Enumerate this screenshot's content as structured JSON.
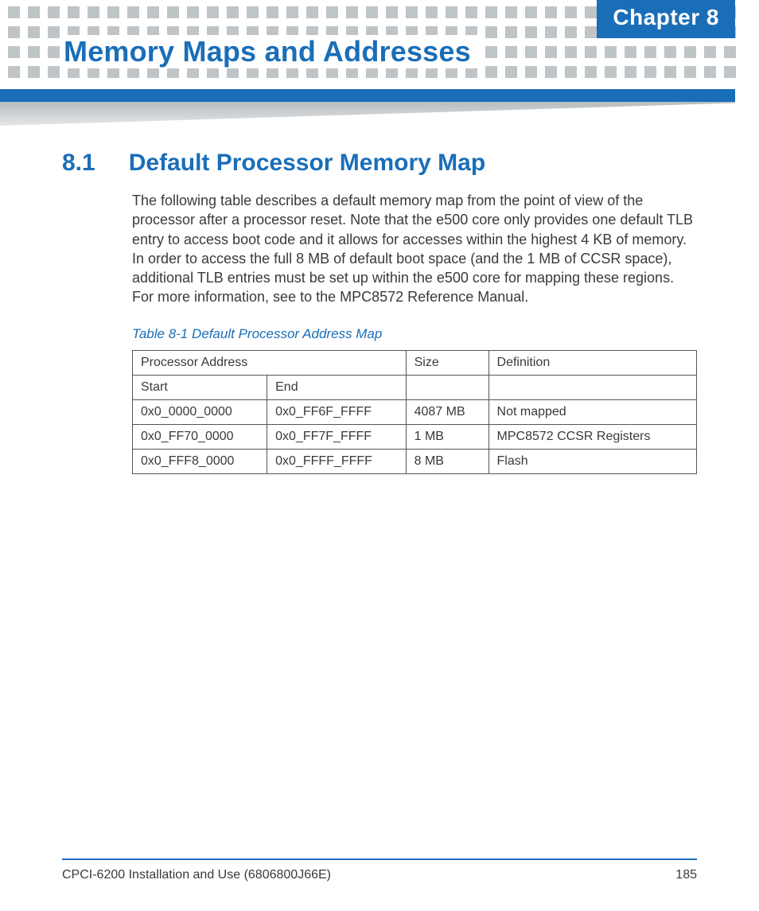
{
  "header": {
    "chapter_label": "Chapter 8",
    "page_title": "Memory Maps and Addresses"
  },
  "section": {
    "number": "8.1",
    "title": "Default Processor Memory Map",
    "paragraph": "The following table describes a default memory map from the point of view of the processor after a processor reset. Note that the e500 core only provides one default TLB entry to access boot code and it allows for accesses within the highest 4 KB of memory. In order to access the full 8 MB of default boot space (and the 1 MB of CCSR space), additional TLB entries must be set up within the e500 core for mapping these regions. For more information, see to the MPC8572 Reference Manual."
  },
  "table": {
    "caption": "Table 8-1 Default Processor Address Map",
    "h_proc_addr": "Processor Address",
    "h_size": "Size",
    "h_def": "Definition",
    "h_start": "Start",
    "h_end": "End",
    "rows": [
      {
        "start": "0x0_0000_0000",
        "end": "0x0_FF6F_FFFF",
        "size": "4087 MB",
        "def": "Not mapped"
      },
      {
        "start": "0x0_FF70_0000",
        "end": "0x0_FF7F_FFFF",
        "size": "1 MB",
        "def": "MPC8572 CCSR Registers"
      },
      {
        "start": "0x0_FFF8_0000",
        "end": "0x0_FFFF_FFFF",
        "size": " 8 MB",
        "def": "Flash"
      }
    ]
  },
  "footer": {
    "doc_title": "CPCI-6200 Installation and Use (6806800J66E)",
    "page_number": "185"
  }
}
